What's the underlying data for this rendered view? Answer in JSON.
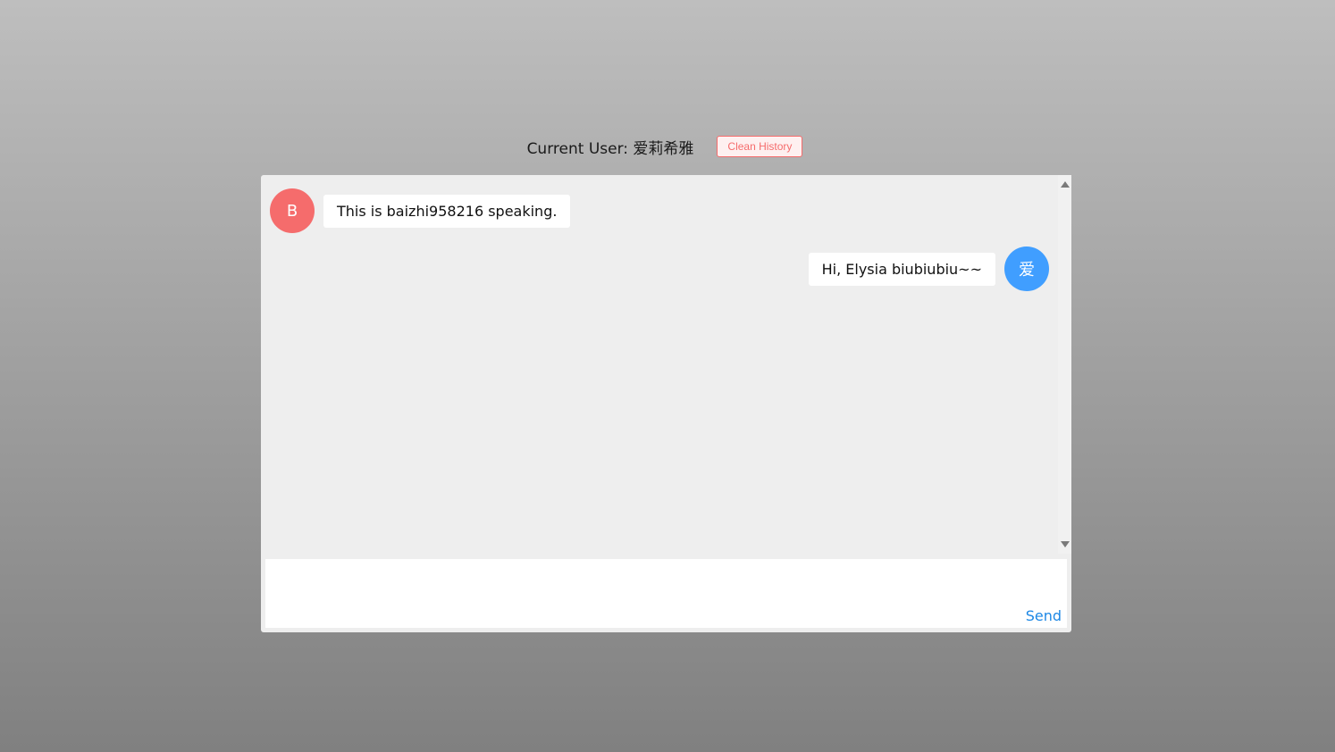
{
  "header": {
    "current_user_label": "Current User: 爱莉希雅",
    "clean_history_label": "Clean History"
  },
  "messages": [
    {
      "side": "left",
      "avatar_text": "B",
      "avatar_color": "#f56c6c",
      "text": "This is baizhi958216 speaking."
    },
    {
      "side": "right",
      "avatar_text": "爱",
      "avatar_color": "#409eff",
      "text": "Hi, Elysia biubiubiu~~"
    }
  ],
  "composer": {
    "value": "",
    "send_label": "Send"
  },
  "colors": {
    "accent": "#409eff",
    "danger": "#f56c6c",
    "send": "#1e88e5",
    "chat_background": "#eeeeee"
  }
}
